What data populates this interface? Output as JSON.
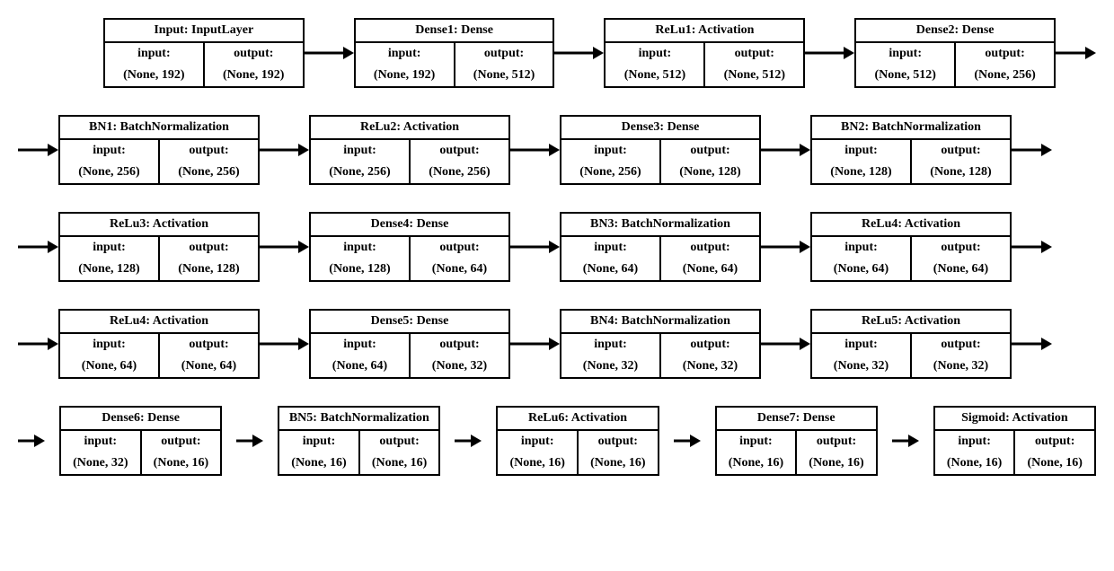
{
  "labels": {
    "input": "input:",
    "output": "output:"
  },
  "rows": [
    {
      "leading_arrow": false,
      "trailing_arrow": true,
      "five": false,
      "layers": [
        {
          "title": "Input: InputLayer",
          "in": "(None, 192)",
          "out": "(None, 192)"
        },
        {
          "title": "Dense1: Dense",
          "in": "(None, 192)",
          "out": "(None, 512)"
        },
        {
          "title": "ReLu1: Activation",
          "in": "(None, 512)",
          "out": "(None, 512)"
        },
        {
          "title": "Dense2: Dense",
          "in": "(None, 512)",
          "out": "(None, 256)"
        }
      ]
    },
    {
      "leading_arrow": true,
      "trailing_arrow": true,
      "five": false,
      "layers": [
        {
          "title": "BN1: BatchNormalization",
          "in": "(None, 256)",
          "out": "(None, 256)"
        },
        {
          "title": "ReLu2: Activation",
          "in": "(None, 256)",
          "out": "(None, 256)"
        },
        {
          "title": "Dense3: Dense",
          "in": "(None, 256)",
          "out": "(None, 128)"
        },
        {
          "title": "BN2: BatchNormalization",
          "in": "(None, 128)",
          "out": "(None, 128)"
        }
      ]
    },
    {
      "leading_arrow": true,
      "trailing_arrow": true,
      "five": false,
      "layers": [
        {
          "title": "ReLu3: Activation",
          "in": "(None, 128)",
          "out": "(None, 128)"
        },
        {
          "title": "Dense4: Dense",
          "in": "(None, 128)",
          "out": "(None, 64)"
        },
        {
          "title": "BN3: BatchNormalization",
          "in": "(None, 64)",
          "out": "(None, 64)"
        },
        {
          "title": "ReLu4: Activation",
          "in": "(None, 64)",
          "out": "(None, 64)"
        }
      ]
    },
    {
      "leading_arrow": true,
      "trailing_arrow": true,
      "five": false,
      "layers": [
        {
          "title": "ReLu4: Activation",
          "in": "(None, 64)",
          "out": "(None, 64)"
        },
        {
          "title": "Dense5: Dense",
          "in": "(None, 64)",
          "out": "(None, 32)"
        },
        {
          "title": "BN4: BatchNormalization",
          "in": "(None, 32)",
          "out": "(None, 32)"
        },
        {
          "title": "ReLu5: Activation",
          "in": "(None, 32)",
          "out": "(None, 32)"
        }
      ]
    },
    {
      "leading_arrow": true,
      "trailing_arrow": false,
      "five": true,
      "layers": [
        {
          "title": "Dense6: Dense",
          "in": "(None, 32)",
          "out": "(None, 16)"
        },
        {
          "title": "BN5: BatchNormalization",
          "in": "(None, 16)",
          "out": "(None, 16)"
        },
        {
          "title": "ReLu6: Activation",
          "in": "(None, 16)",
          "out": "(None, 16)"
        },
        {
          "title": "Dense7: Dense",
          "in": "(None, 16)",
          "out": "(None, 16)"
        },
        {
          "title": "Sigmoid: Activation",
          "in": "(None, 16)",
          "out": "(None, 16)"
        }
      ]
    }
  ]
}
